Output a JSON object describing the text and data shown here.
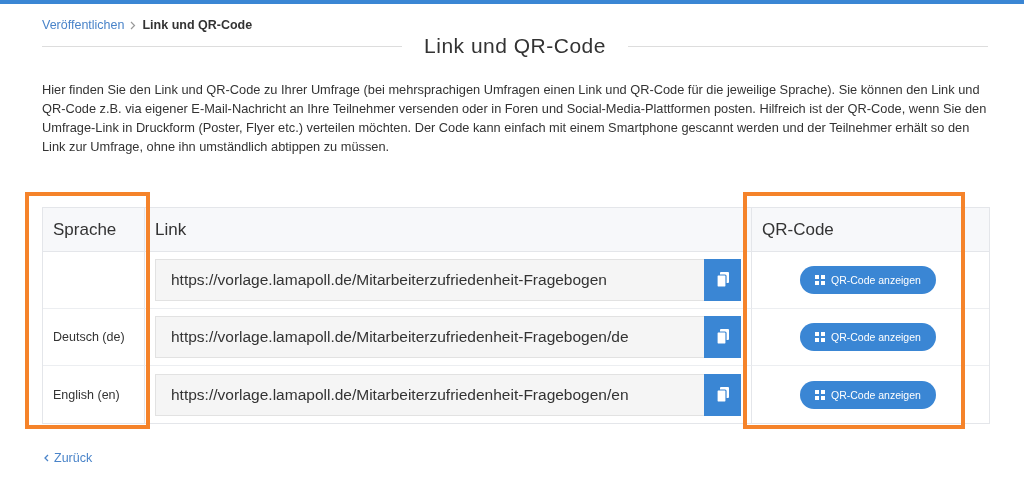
{
  "breadcrumb": [
    {
      "label": "Veröffentlichen",
      "kind": "link"
    },
    {
      "label": "Link und QR-Code",
      "kind": "current"
    }
  ],
  "title": "Link und QR-Code",
  "intro": "Hier finden Sie den Link und QR-Code zu Ihrer Umfrage (bei mehrsprachigen Umfragen einen Link und QR-Code für die jeweilige Sprache). Sie können den Link und QR-Code z.B. via eigener E-Mail-Nachricht an Ihre Teilnehmer versenden oder in Foren und Social-Media-Plattformen posten. Hilfreich ist der QR-Code, wenn Sie den Umfrage-Link in Druckform (Poster, Flyer etc.) verteilen möchten. Der Code kann einfach mit einem Smartphone gescannt werden und der Teilnehmer erhält so den Link zur Umfrage, ohne ihn umständlich abtippen zu müssen.",
  "table": {
    "columns": [
      {
        "label": "Sprache",
        "highlighted": true
      },
      {
        "label": "Link",
        "highlighted": false
      },
      {
        "label": "QR-Code",
        "highlighted": true
      }
    ],
    "rows": [
      {
        "language": "",
        "link": "https://vorlage.lamapoll.de/Mitarbeiterzufriedenheit-Fragebogen",
        "qr_button": "QR-Code anzeigen"
      },
      {
        "language": "Deutsch (de)",
        "link": "https://vorlage.lamapoll.de/Mitarbeiterzufriedenheit-Fragebogen/de",
        "qr_button": "QR-Code anzeigen"
      },
      {
        "language": "English (en)",
        "link": "https://vorlage.lamapoll.de/Mitarbeiterzufriedenheit-Fragebogen/en",
        "qr_button": "QR-Code anzeigen"
      }
    ]
  },
  "back_link": "Zurück"
}
